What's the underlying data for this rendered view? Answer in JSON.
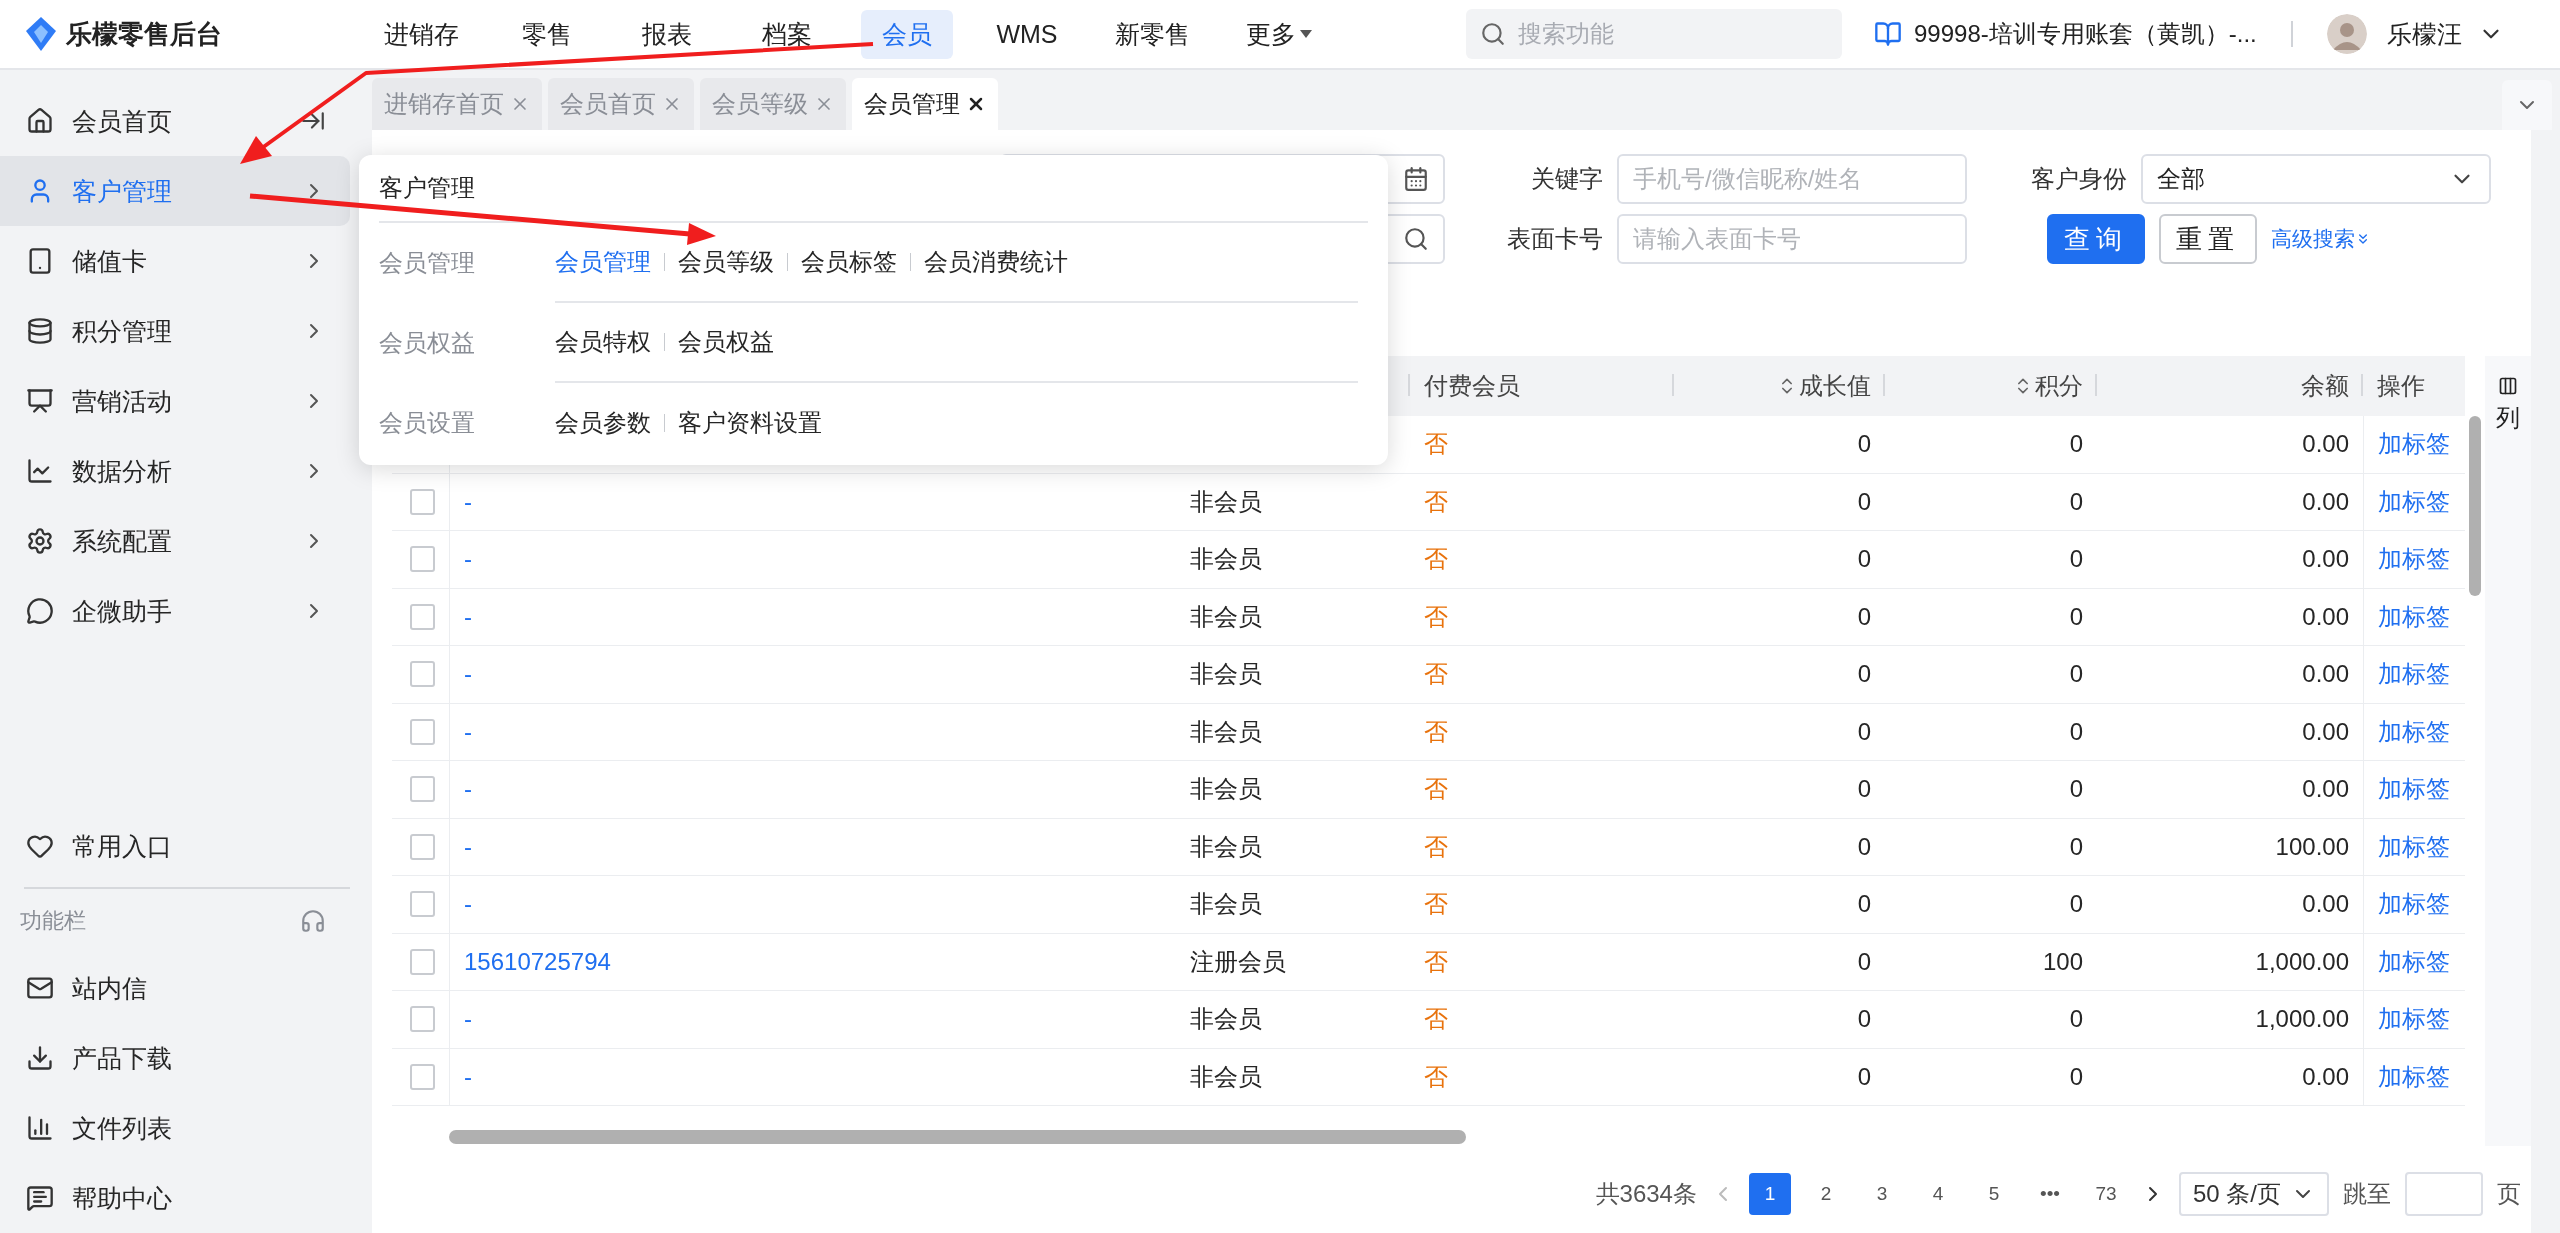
{
  "header": {
    "brand": "乐檬零售后台",
    "nav": [
      {
        "label": "进销存",
        "selected": false,
        "dropdown": false
      },
      {
        "label": "零售",
        "selected": false,
        "dropdown": false
      },
      {
        "label": "报表",
        "selected": false,
        "dropdown": false
      },
      {
        "label": "档案",
        "selected": false,
        "dropdown": false
      },
      {
        "label": "会员",
        "selected": true,
        "dropdown": false
      },
      {
        "label": "WMS",
        "selected": false,
        "dropdown": false
      },
      {
        "label": "新零售",
        "selected": false,
        "dropdown": false
      },
      {
        "label": "更多",
        "selected": false,
        "dropdown": true
      }
    ],
    "search": {
      "placeholder": "搜索功能"
    },
    "account": "99998-培训专用账套（黄凯）-...",
    "user": "乐檬汪"
  },
  "sidebar": {
    "items": [
      {
        "label": "会员首页",
        "selected": false,
        "expandable": false
      },
      {
        "label": "客户管理",
        "selected": true,
        "expandable": true
      },
      {
        "label": "储值卡",
        "selected": false,
        "expandable": true
      },
      {
        "label": "积分管理",
        "selected": false,
        "expandable": true
      },
      {
        "label": "营销活动",
        "selected": false,
        "expandable": true
      },
      {
        "label": "数据分析",
        "selected": false,
        "expandable": true
      },
      {
        "label": "系统配置",
        "selected": false,
        "expandable": true
      },
      {
        "label": "企微助手",
        "selected": false,
        "expandable": true
      }
    ],
    "favorites": "常用入口",
    "section_title": "功能栏",
    "tools": [
      {
        "label": "站内信"
      },
      {
        "label": "产品下载"
      },
      {
        "label": "文件列表"
      },
      {
        "label": "帮助中心"
      }
    ]
  },
  "tabs": [
    {
      "label": "进销存首页",
      "selected": false
    },
    {
      "label": "会员首页",
      "selected": false
    },
    {
      "label": "会员等级",
      "selected": false
    },
    {
      "label": "会员管理",
      "selected": true
    }
  ],
  "filters": {
    "keyword": {
      "label": "关键字",
      "placeholder": "手机号/微信昵称/姓名"
    },
    "identity": {
      "label": "客户身份",
      "value": "全部"
    },
    "card": {
      "label": "表面卡号",
      "placeholder": "请输入表面卡号"
    },
    "query": "查询",
    "reset": "重置",
    "advanced": "高级搜索"
  },
  "popup": {
    "title": "客户管理",
    "groups": [
      {
        "label": "会员管理",
        "links": [
          {
            "label": "会员管理",
            "selected": true
          },
          {
            "label": "会员等级",
            "selected": false
          },
          {
            "label": "会员标签",
            "selected": false
          },
          {
            "label": "会员消费统计",
            "selected": false
          }
        ]
      },
      {
        "label": "会员权益",
        "links": [
          {
            "label": "会员特权",
            "selected": false
          },
          {
            "label": "会员权益",
            "selected": false
          }
        ]
      },
      {
        "label": "会员设置",
        "links": [
          {
            "label": "会员参数",
            "selected": false
          },
          {
            "label": "客户资料设置",
            "selected": false
          }
        ]
      }
    ]
  },
  "table": {
    "columns": [
      {
        "label": "付费会员",
        "sortable": false
      },
      {
        "label": "成长值",
        "sortable": true
      },
      {
        "label": "积分",
        "sortable": true
      },
      {
        "label": "余额",
        "sortable": false
      },
      {
        "label": "操作",
        "sortable": false
      }
    ],
    "column_settings": "列",
    "rows": [
      {
        "paid": "否",
        "growth": "0",
        "points": "0",
        "balance": "0.00",
        "action": "加标签"
      },
      {
        "checked": false,
        "customer": "-",
        "type": "非会员",
        "paid": "否",
        "growth": "0",
        "points": "0",
        "balance": "0.00",
        "action": "加标签"
      },
      {
        "checked": false,
        "customer": "-",
        "type": "非会员",
        "paid": "否",
        "growth": "0",
        "points": "0",
        "balance": "0.00",
        "action": "加标签"
      },
      {
        "checked": false,
        "customer": "-",
        "type": "非会员",
        "paid": "否",
        "growth": "0",
        "points": "0",
        "balance": "0.00",
        "action": "加标签"
      },
      {
        "checked": false,
        "customer": "-",
        "type": "非会员",
        "paid": "否",
        "growth": "0",
        "points": "0",
        "balance": "0.00",
        "action": "加标签"
      },
      {
        "checked": false,
        "customer": "-",
        "type": "非会员",
        "paid": "否",
        "growth": "0",
        "points": "0",
        "balance": "0.00",
        "action": "加标签"
      },
      {
        "checked": false,
        "customer": "-",
        "type": "非会员",
        "paid": "否",
        "growth": "0",
        "points": "0",
        "balance": "0.00",
        "action": "加标签"
      },
      {
        "checked": false,
        "customer": "-",
        "type": "非会员",
        "paid": "否",
        "growth": "0",
        "points": "0",
        "balance": "100.00",
        "action": "加标签"
      },
      {
        "checked": false,
        "customer": "-",
        "type": "非会员",
        "paid": "否",
        "growth": "0",
        "points": "0",
        "balance": "0.00",
        "action": "加标签"
      },
      {
        "checked": false,
        "customer": "15610725794",
        "type": "注册会员",
        "paid": "否",
        "growth": "0",
        "points": "100",
        "balance": "1,000.00",
        "action": "加标签"
      },
      {
        "checked": false,
        "customer": "-",
        "type": "非会员",
        "paid": "否",
        "growth": "0",
        "points": "0",
        "balance": "1,000.00",
        "action": "加标签"
      },
      {
        "checked": false,
        "customer": "-",
        "type": "非会员",
        "paid": "否",
        "growth": "0",
        "points": "0",
        "balance": "0.00",
        "action": "加标签"
      }
    ]
  },
  "pagination": {
    "total": "共3634条",
    "pages": [
      {
        "label": "1",
        "selected": true
      },
      {
        "label": "2",
        "selected": false
      },
      {
        "label": "3",
        "selected": false
      },
      {
        "label": "4",
        "selected": false
      },
      {
        "label": "5",
        "selected": false
      },
      {
        "label": "•••",
        "selected": false
      },
      {
        "label": "73",
        "selected": false
      }
    ],
    "page_size": "50 条/页",
    "jump_label": "跳至",
    "page_unit": "页"
  }
}
